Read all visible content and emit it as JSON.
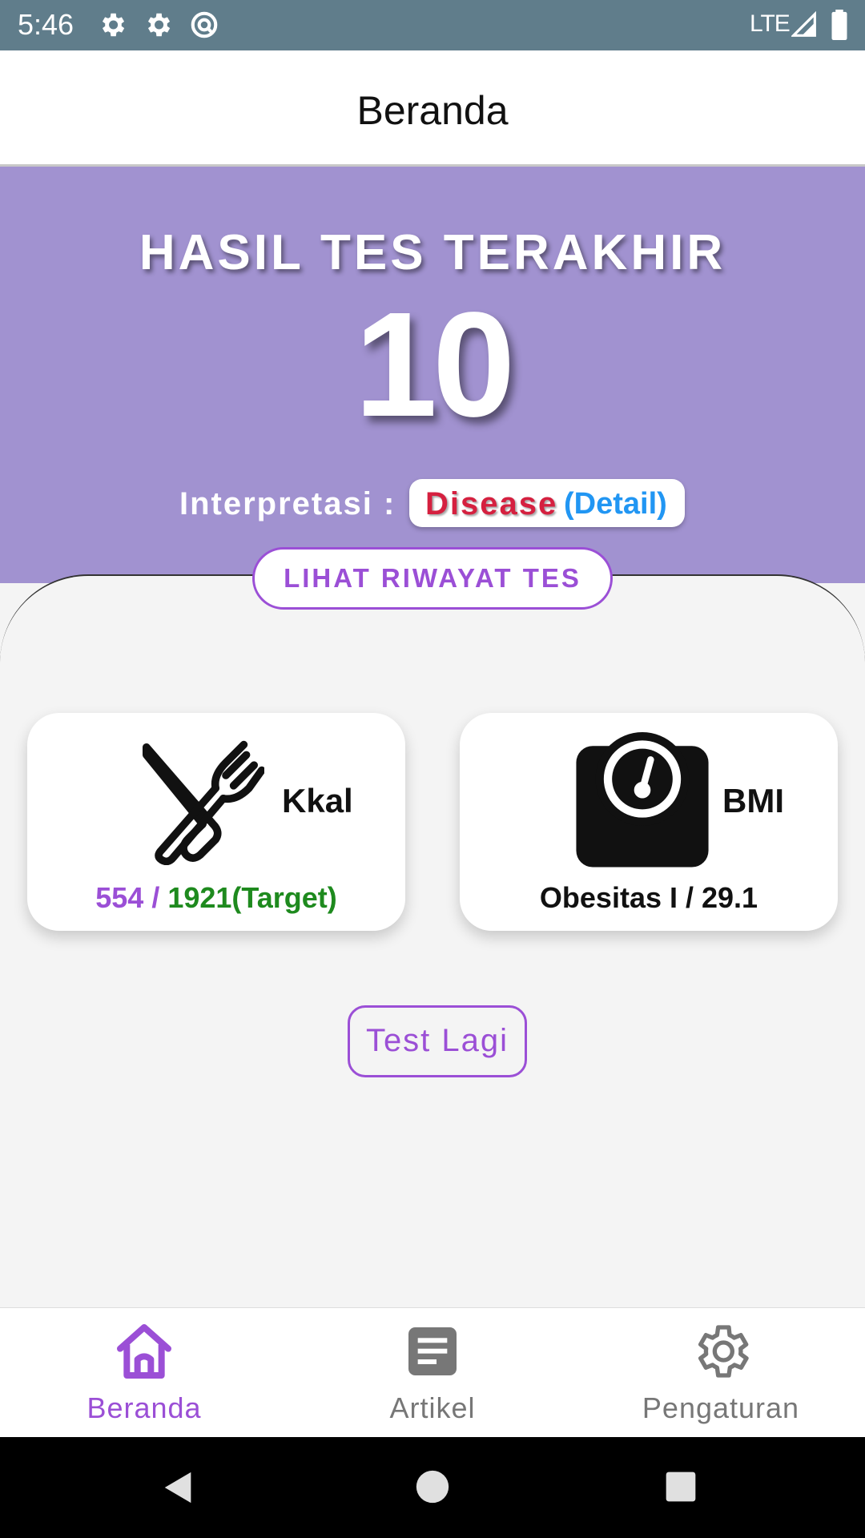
{
  "status_bar": {
    "time": "5:46",
    "network": "LTE",
    "icons": [
      "settings-icon",
      "settings-icon",
      "sync-icon",
      "signal-icon",
      "battery-icon"
    ]
  },
  "app_bar": {
    "title": "Beranda"
  },
  "hero": {
    "title": "HASIL TES TERAKHIR",
    "score": "10",
    "interpretation_label": "Interpretasi :",
    "interpretation_value": "Disease",
    "interpretation_detail": "(Detail)",
    "history_button": "LIHAT RIWAYAT TES"
  },
  "cards": {
    "kkal": {
      "label": "Kkal",
      "icon": "utensils-icon",
      "consumed": "554 / ",
      "target": "1921(Target)"
    },
    "bmi": {
      "label": "BMI",
      "icon": "scale-icon",
      "value": "Obesitas I / 29.1"
    }
  },
  "test_button": "Test Lagi",
  "bottom_nav": {
    "items": [
      {
        "label": "Beranda",
        "icon": "home-icon",
        "active": true
      },
      {
        "label": "Artikel",
        "icon": "article-icon",
        "active": false
      },
      {
        "label": "Pengaturan",
        "icon": "settings-icon",
        "active": false
      }
    ]
  },
  "system_nav": {
    "icons": [
      "back-icon",
      "home-circle-icon",
      "recents-icon"
    ]
  },
  "colors": {
    "status_bar": "#607d8b",
    "hero": "#a192d0",
    "accent": "#9b4fd6",
    "disease": "#d5203f",
    "detail": "#2196f3",
    "target": "#1e8a1e",
    "inactive": "#777777"
  }
}
